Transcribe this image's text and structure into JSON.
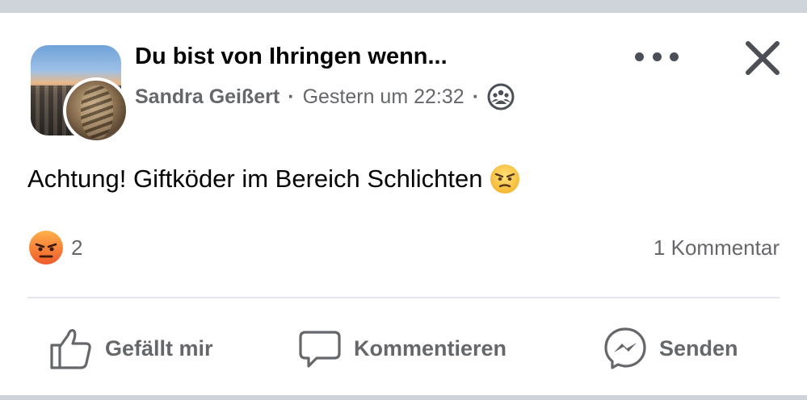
{
  "post": {
    "group_name": "Du bist von Ihringen wenn...",
    "author": "Sandra Geißert",
    "separator": "·",
    "timestamp": "Gestern um 22:32",
    "audience_icon": "group-members-icon",
    "text": "Achtung! Giftköder im Bereich Schlichten",
    "text_emoji": "weary-face-emoji"
  },
  "reactions": {
    "icon": "angry-reaction-icon",
    "count": "2",
    "comments_label": "1 Kommentar"
  },
  "actions": {
    "like_label": "Gefällt mir",
    "comment_label": "Kommentieren",
    "send_label": "Senden"
  },
  "colors": {
    "text": "#050505",
    "secondary_text": "#65676b",
    "angry_top": "#ffda6a",
    "angry_bottom": "#f0662f",
    "divider": "#e4e6eb",
    "chrome_bar": "#cfd3da"
  }
}
